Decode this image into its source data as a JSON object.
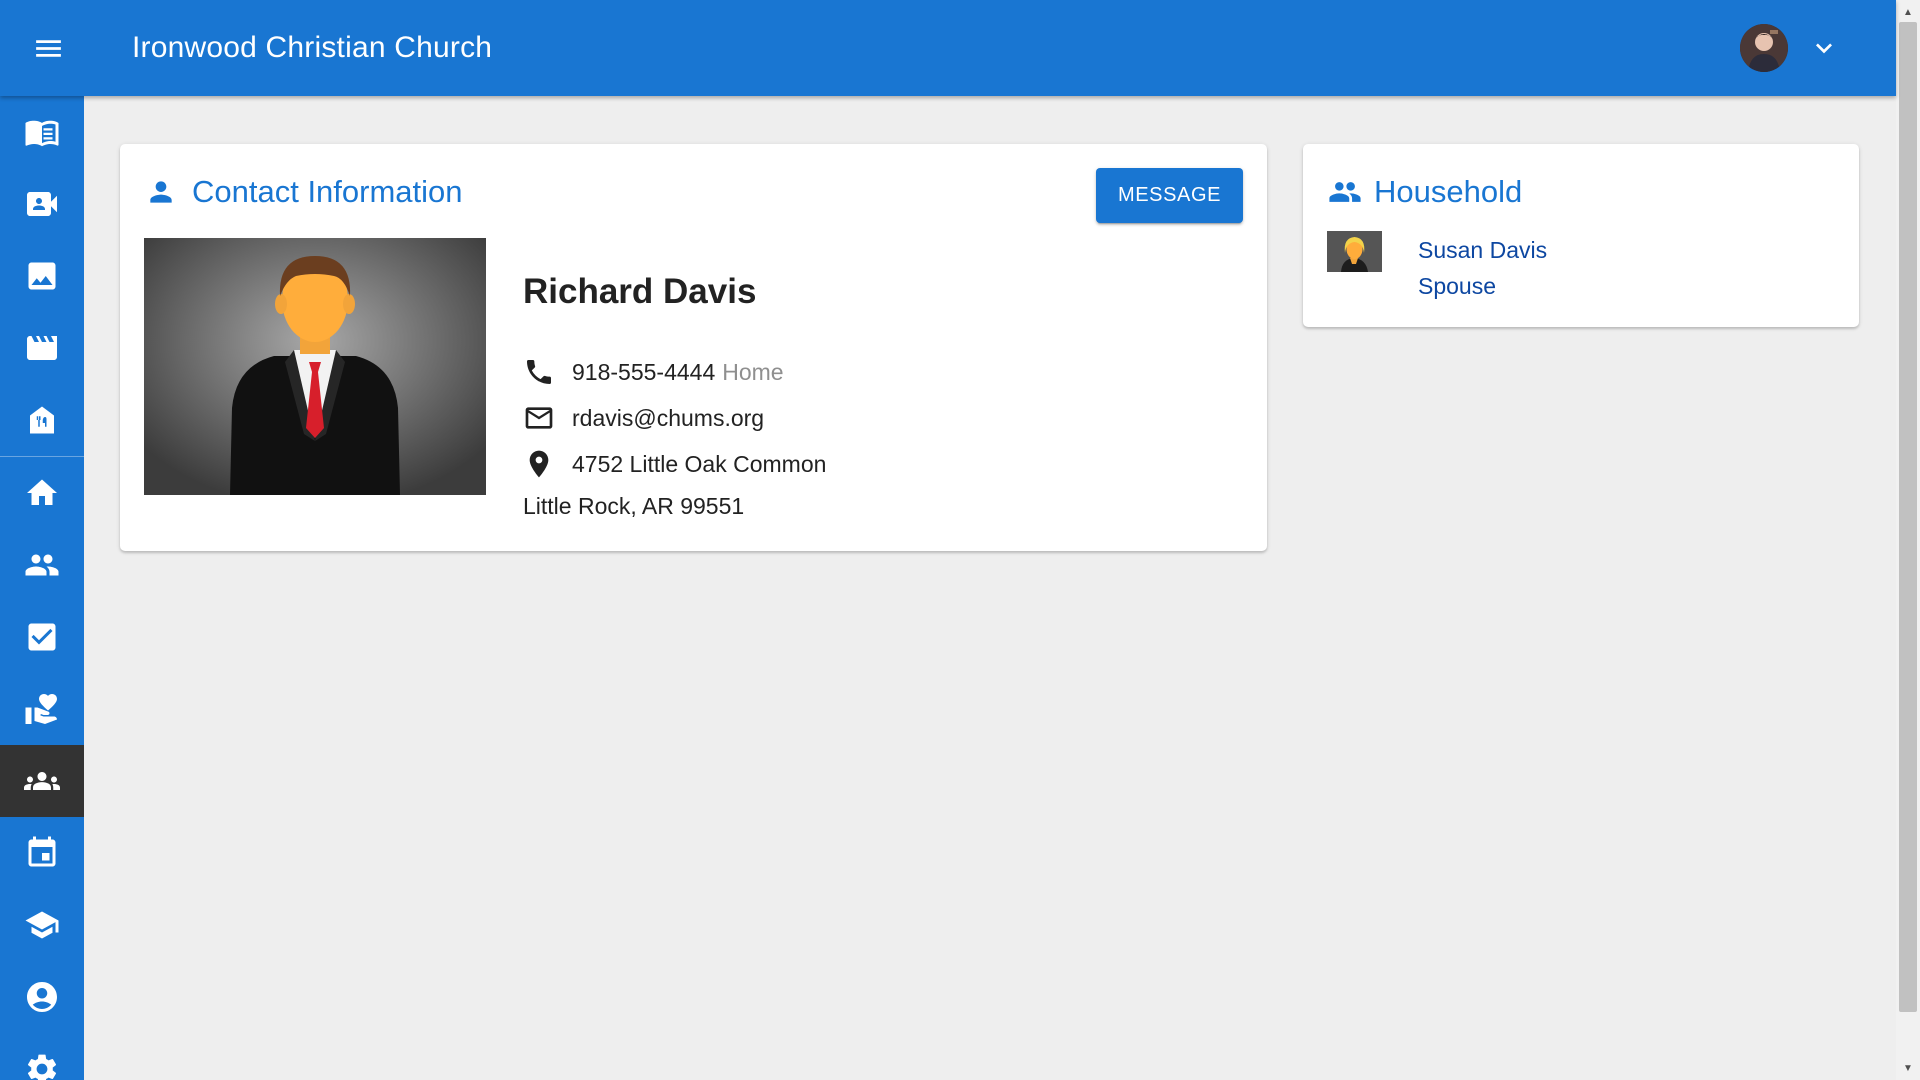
{
  "app": {
    "title": "Ironwood Christian Church"
  },
  "header": {
    "menu_icon": "menu-icon",
    "avatar_icon": "user-avatar",
    "dropdown_icon": "chevron-down-icon"
  },
  "sidebar": {
    "items": [
      {
        "icon": "bible-icon"
      },
      {
        "icon": "video-icon"
      },
      {
        "icon": "image-icon"
      },
      {
        "icon": "movie-icon"
      },
      {
        "icon": "church-icon"
      },
      {
        "icon": "home-icon"
      },
      {
        "icon": "people-icon"
      },
      {
        "icon": "checkbox-icon"
      },
      {
        "icon": "donation-icon"
      },
      {
        "icon": "groups-icon",
        "active": true
      },
      {
        "icon": "calendar-icon"
      },
      {
        "icon": "school-icon"
      },
      {
        "icon": "account-circle-icon"
      },
      {
        "icon": "settings-icon"
      }
    ]
  },
  "contact": {
    "title": "Contact Information",
    "message_button": "MESSAGE",
    "name": "Richard Davis",
    "phone": "918-555-4444",
    "phone_type": "Home",
    "email": "rdavis@chums.org",
    "address_line1": "4752 Little Oak Common",
    "address_line2": "Little Rock, AR 99551"
  },
  "household": {
    "title": "Household",
    "members": [
      {
        "name": "Susan Davis",
        "role": "Spouse"
      }
    ]
  },
  "colors": {
    "primary": "#1976d2",
    "active_nav": "#333333",
    "link": "#0d47a1",
    "background": "#eeeeee"
  }
}
